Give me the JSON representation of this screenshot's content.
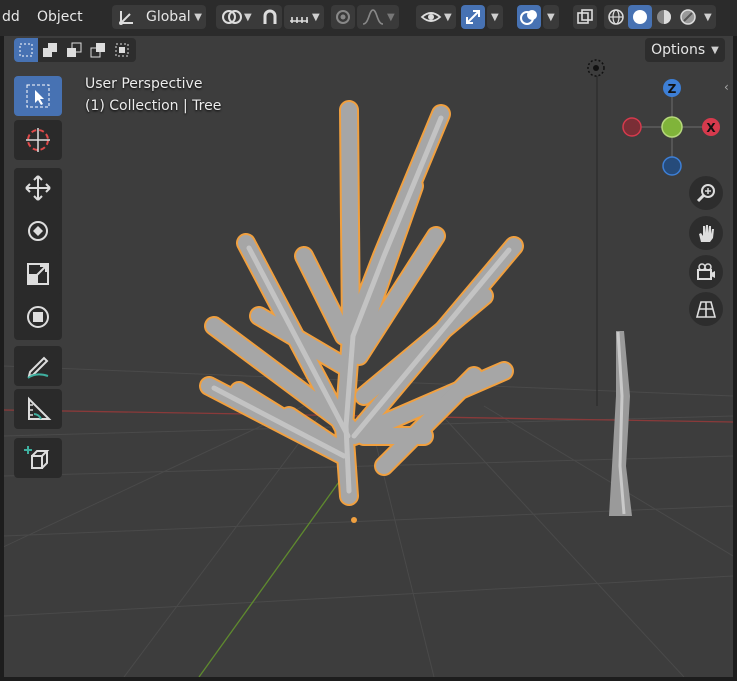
{
  "header": {
    "editor_label": "dd",
    "mode_label": "Object",
    "orientation_label": "Global",
    "options_label": "Options"
  },
  "viewport": {
    "view_name": "User Perspective",
    "collection_line": "(1) Collection | Tree"
  },
  "gizmo": {
    "z_label": "Z",
    "x_label": "X"
  },
  "tools": [
    "select-box",
    "cursor",
    "move",
    "rotate",
    "scale",
    "transform",
    "annotate",
    "measure",
    "add-cube"
  ],
  "colors": {
    "accent": "#4772b3",
    "selection_outline": "#f0a040",
    "x_axis": "#d63a4d",
    "y_axis": "#80b43a",
    "z_axis": "#3d7fd6"
  }
}
